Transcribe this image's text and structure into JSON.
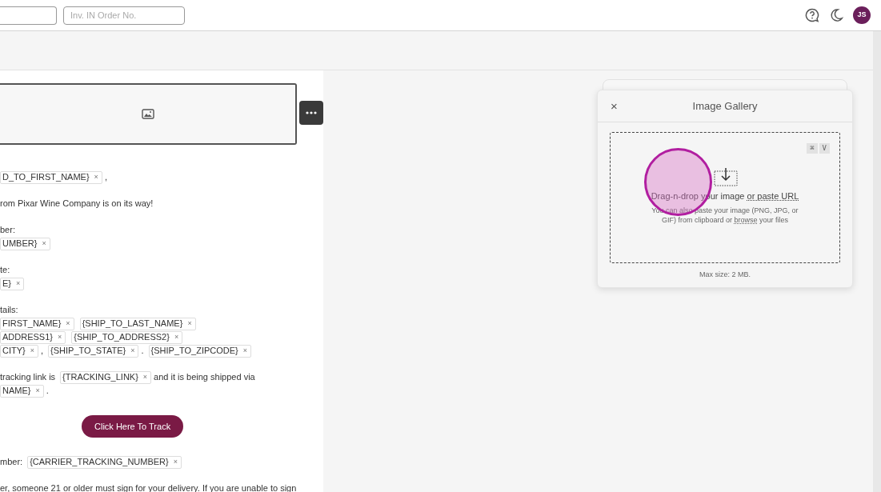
{
  "header": {
    "order_field": {
      "placeholder": "Inv. IN Order No."
    },
    "avatar": "JS"
  },
  "email": {
    "paragraphs": [
      {
        "kind": "text",
        "lines": [
          [
            {
              "kind": "chip",
              "text": "D_TO_FIRST_NAME}",
              "remove": "×"
            },
            {
              "kind": "text",
              "text": ","
            }
          ]
        ]
      },
      {
        "kind": "text",
        "lines": [
          [
            {
              "kind": "text",
              "text": "rom Pixar Wine Company is on its way!"
            }
          ]
        ]
      },
      {
        "kind": "text",
        "lines": [
          [
            {
              "kind": "text",
              "text": "ber:"
            }
          ],
          [
            {
              "kind": "chip",
              "text": "UMBER}",
              "remove": "×"
            }
          ]
        ]
      },
      {
        "kind": "text",
        "lines": [
          [
            {
              "kind": "text",
              "text": "te:"
            }
          ],
          [
            {
              "kind": "chip",
              "text": "E}",
              "remove": "×"
            }
          ]
        ]
      },
      {
        "kind": "text",
        "lines": [
          [
            {
              "kind": "text",
              "text": "tails:"
            }
          ],
          [
            {
              "kind": "chip",
              "text": "FIRST_NAME}",
              "remove": "×"
            },
            {
              "kind": "chip",
              "text": "{SHIP_TO_LAST_NAME}",
              "remove": "×"
            }
          ],
          [
            {
              "kind": "chip",
              "text": "ADDRESS1}",
              "remove": "×"
            },
            {
              "kind": "chip",
              "text": "{SHIP_TO_ADDRESS2}",
              "remove": "×"
            }
          ],
          [
            {
              "kind": "chip",
              "text": "CITY}",
              "remove": "×"
            },
            {
              "kind": "text",
              "text": ","
            },
            {
              "kind": "chip",
              "text": "{SHIP_TO_STATE}",
              "remove": "×"
            },
            {
              "kind": "text",
              "text": "."
            },
            {
              "kind": "chip",
              "text": "{SHIP_TO_ZIPCODE}",
              "remove": "×"
            }
          ]
        ]
      },
      {
        "kind": "text",
        "lines": [
          [
            {
              "kind": "text",
              "text": "tracking link is"
            },
            {
              "kind": "chip",
              "text": "{TRACKING_LINK}",
              "remove": "×"
            },
            {
              "kind": "text",
              "text": "and it is being shipped via"
            }
          ],
          [
            {
              "kind": "chip",
              "text": "NAME}",
              "remove": "×"
            },
            {
              "kind": "text",
              "text": "."
            }
          ]
        ]
      },
      {
        "kind": "button",
        "label": "Click Here To Track"
      },
      {
        "kind": "text",
        "lines": [
          [
            {
              "kind": "text",
              "text": "mber:"
            },
            {
              "kind": "chip",
              "text": "{CARRIER_TRACKING_NUMBER}",
              "remove": "×"
            }
          ]
        ]
      },
      {
        "kind": "text",
        "lines": [
          [
            {
              "kind": "text",
              "text": "er, someone 21 or older must sign for your delivery. If you are unable to sign"
            }
          ]
        ]
      }
    ]
  },
  "gallery": {
    "close": "×",
    "title": "Image Gallery",
    "keys": [
      "⌘",
      "V"
    ],
    "drop_text": "Drag-n-drop your image",
    "drop_link": "or paste URL",
    "hint_before": "You can also paste your image (PNG, JPG, or GIF) from clipboard or",
    "hint_link": "browse",
    "hint_after": "your files",
    "max_size": "Max size: 2 MB."
  }
}
